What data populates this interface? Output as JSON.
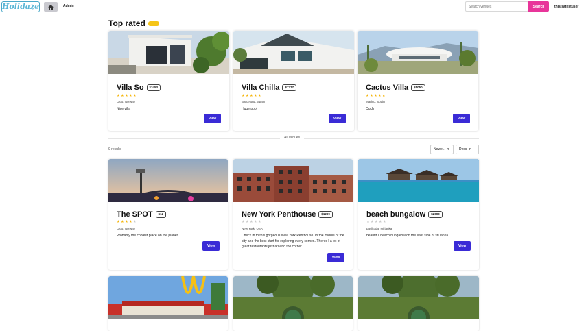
{
  "nav": {
    "logo": "Holidaze",
    "admin": "Admin",
    "search_placeholder": "Search venues",
    "search_button": "Search",
    "user": "thisisatestuser"
  },
  "top_rated": {
    "heading": "Top rated",
    "cards": [
      {
        "name": "Villa So",
        "price": "$3453",
        "stars": 5,
        "location": "Oslo, Norway",
        "description": "Nice villa",
        "button": "View"
      },
      {
        "name": "Villa Chilla",
        "price": "$7777",
        "stars": 5,
        "location": "Barcelona, Spain",
        "description": "Huge pool",
        "button": "View"
      },
      {
        "name": "Cactus Villa",
        "price": "$5050",
        "stars": 5,
        "location": "Madrid, Spain",
        "description": "Ouch",
        "button": "View"
      }
    ]
  },
  "all_venues": {
    "label": "All venues",
    "results": "9 results",
    "sort1": "Newe...",
    "sort2": "Desc",
    "cards": [
      {
        "name": "The SPOT",
        "price": "$12",
        "stars": 4,
        "location": "Oslo, Norway",
        "description": "Probably the coolest place on the planet",
        "button": "View"
      },
      {
        "name": "New York Penthouse",
        "price": "$1299",
        "stars": 0,
        "location": "New York, USA",
        "description": "Check in to this gorgeous New York Penthouse. In the middle of the city and the best start for exploring every corner.. Theres l a lot of great restaurants just around the corner...",
        "button": "View"
      },
      {
        "name": "beach bungalow",
        "price": "$2000",
        "stars": 0,
        "location": "paslkuda, sri lanka",
        "description": "beautiful beach bungalow on the east side of sri lanka",
        "button": "View"
      }
    ]
  },
  "colors": {
    "accent": "#3a2bd6",
    "search": "#e8359a",
    "star": "#f5b50a",
    "tag": "#f5c518"
  }
}
